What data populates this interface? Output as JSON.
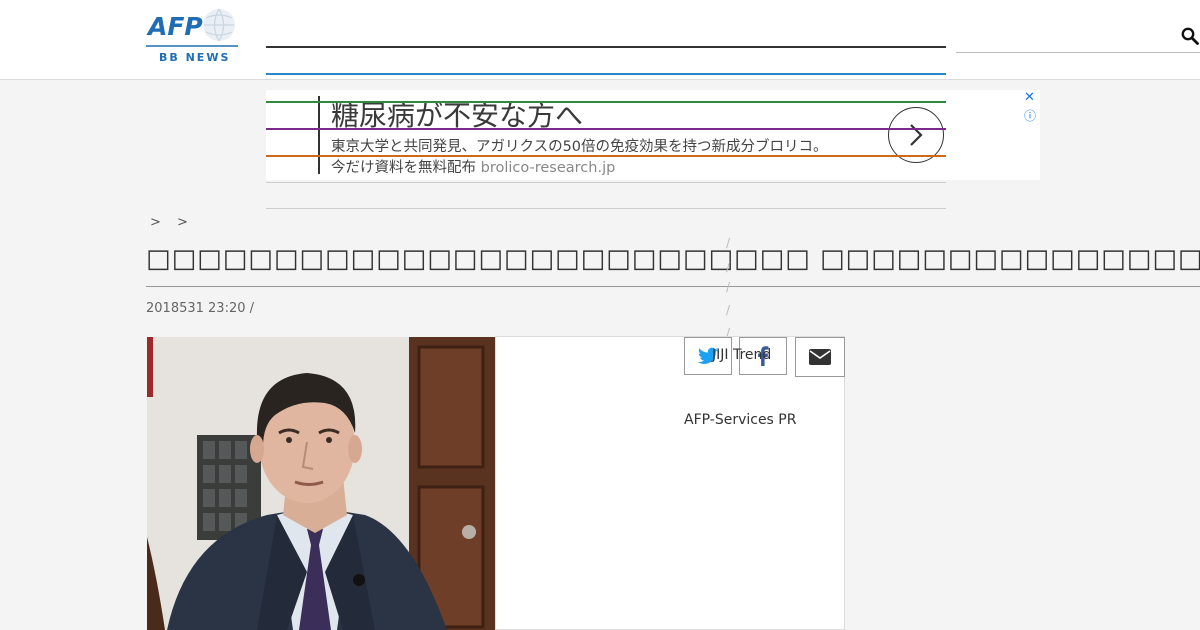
{
  "header": {
    "logo_text": "AFP",
    "logo_subtext": "BB NEWS",
    "search_icon": "search-icon"
  },
  "ad": {
    "title": "糖尿病が不安な方へ",
    "description": "東京大学と共同発見、アガリクスの50倍の免疫効果を持つ新成分ブロリコ。",
    "line2": "今だけ資料を無料配布",
    "domain": "brolico-research.jp",
    "close_icon": "✕",
    "info_icon": "ⓘ"
  },
  "breadcrumb": ">  >",
  "article": {
    "title": "□□□□□□□□□□□□□□□□□□□□□□□□□□ □□□□□□□□□□□□□□□",
    "date": "2018531 23:20  /"
  },
  "sidebar_links": {
    "jiji": "JIJI Trend",
    "afp_services": "AFP-Services PR"
  },
  "share": {
    "twitter_icon": "twitter-icon",
    "facebook_icon": "facebook-icon",
    "mail_icon": "mail-icon"
  },
  "colors": {
    "nav_black": "#333333",
    "nav_blue": "#2a87c8",
    "nav_green": "#2f8a3c",
    "nav_purple": "#7b2a8c",
    "nav_orange": "#d0681a",
    "twitter": "#1da1f2",
    "facebook": "#3b5998"
  }
}
